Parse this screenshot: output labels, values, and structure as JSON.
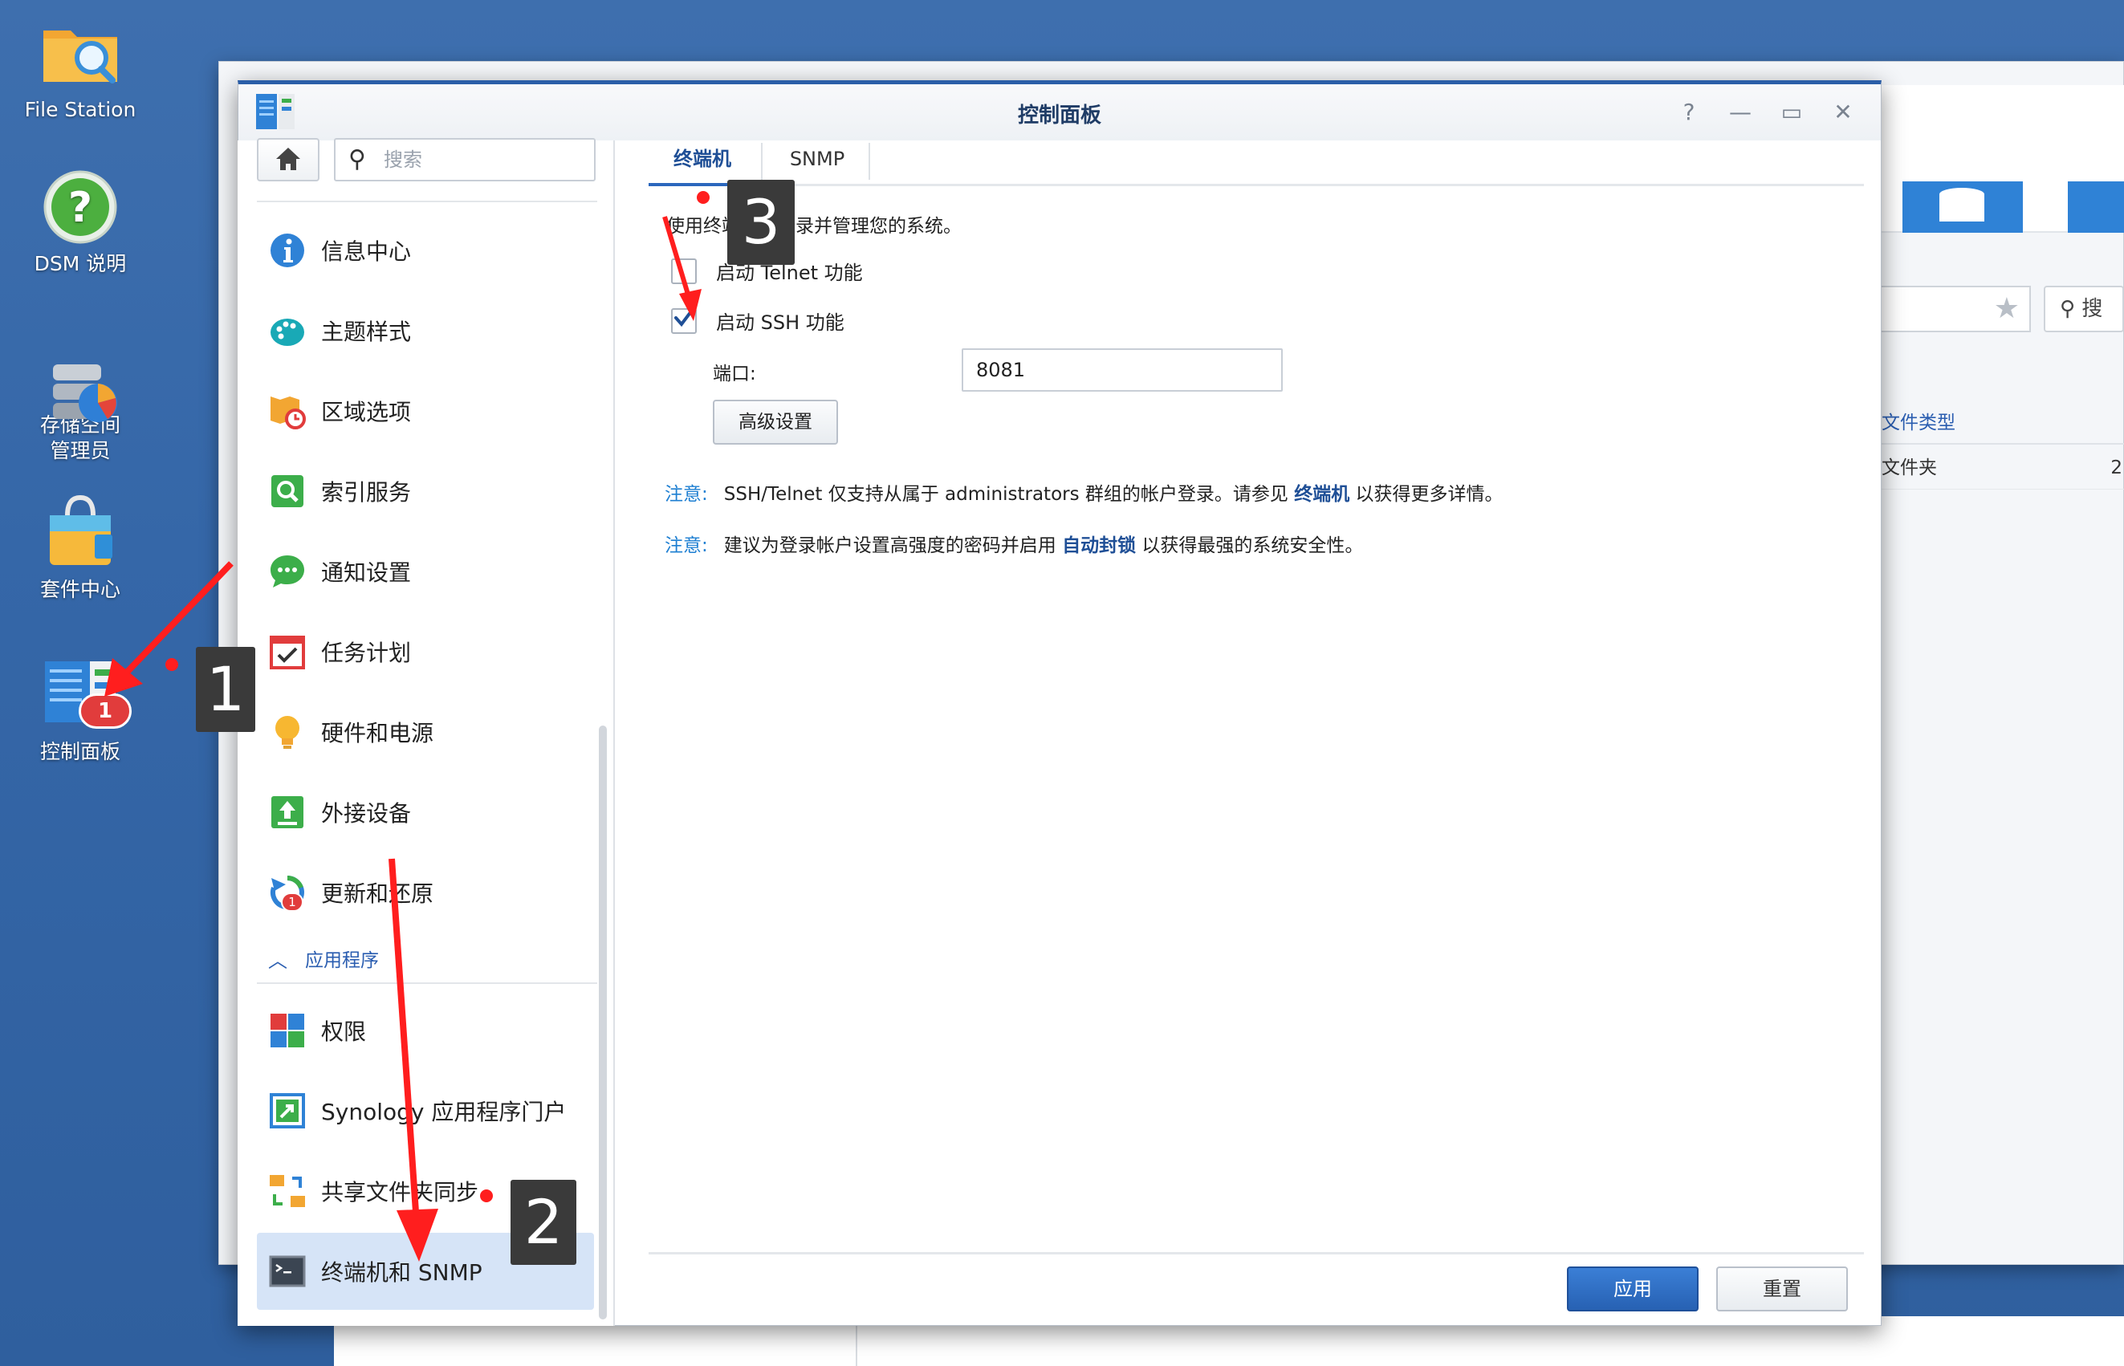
{
  "desktop": {
    "icons": [
      {
        "label": "File Station"
      },
      {
        "label": "DSM 说明"
      },
      {
        "label": "存储空间\n管理员"
      },
      {
        "label": "套件中心"
      },
      {
        "label": "控制面板"
      }
    ],
    "control_panel_badge": "1"
  },
  "background_window": {
    "search_hint": "搜",
    "column_header": "文件类型",
    "row_value": "文件夹",
    "row_trailing": "2"
  },
  "window": {
    "title": "控制面板",
    "help": "?",
    "minimize": "—",
    "maximize": "▭",
    "close": "✕"
  },
  "sidebar": {
    "search_placeholder": "搜索",
    "section_header": "应用程序",
    "items": [
      {
        "label": "信息中心",
        "icon": "info-icon"
      },
      {
        "label": "主题样式",
        "icon": "palette-icon"
      },
      {
        "label": "区域选项",
        "icon": "map-clock-icon"
      },
      {
        "label": "索引服务",
        "icon": "index-search-icon"
      },
      {
        "label": "通知设置",
        "icon": "chat-bubble-icon"
      },
      {
        "label": "任务计划",
        "icon": "calendar-check-icon"
      },
      {
        "label": "硬件和电源",
        "icon": "bulb-icon"
      },
      {
        "label": "外接设备",
        "icon": "upload-icon"
      },
      {
        "label": "更新和还原",
        "icon": "refresh-icon",
        "badge": "1"
      },
      {
        "label": "权限",
        "icon": "permission-icon"
      },
      {
        "label": "Synology 应用程序门户",
        "icon": "portal-icon"
      },
      {
        "label": "共享文件夹同步",
        "icon": "sync-folder-icon"
      },
      {
        "label": "终端机和 SNMP",
        "icon": "terminal-icon",
        "active": true
      }
    ]
  },
  "content": {
    "tabs": [
      {
        "label": "终端机",
        "active": true
      },
      {
        "label": "SNMP",
        "active": false
      }
    ],
    "description": "使用终端机来登录并管理您的系统。",
    "telnet_label": "启动 Telnet 功能",
    "telnet_checked": false,
    "ssh_label": "启动 SSH 功能",
    "ssh_checked": true,
    "port_label": "端口:",
    "port_value": "8081",
    "advanced_button": "高级设置",
    "note1": {
      "label": "注意:",
      "text_before": "SSH/Telnet 仅支持从属于 administrators 群组的帐户登录。请参见 ",
      "link": "终端机",
      "text_after": " 以获得更多详情。"
    },
    "note2": {
      "label": "注意:",
      "text_before": "建议为登录帐户设置高强度的密码并启用 ",
      "link": "自动封锁",
      "text_after": " 以获得最强的系统安全性。"
    },
    "apply_button": "应用",
    "reset_button": "重置"
  },
  "annotations": {
    "step1": "1",
    "step2": "2",
    "step3": "3",
    "arrow_color": "#ff1e1e"
  }
}
